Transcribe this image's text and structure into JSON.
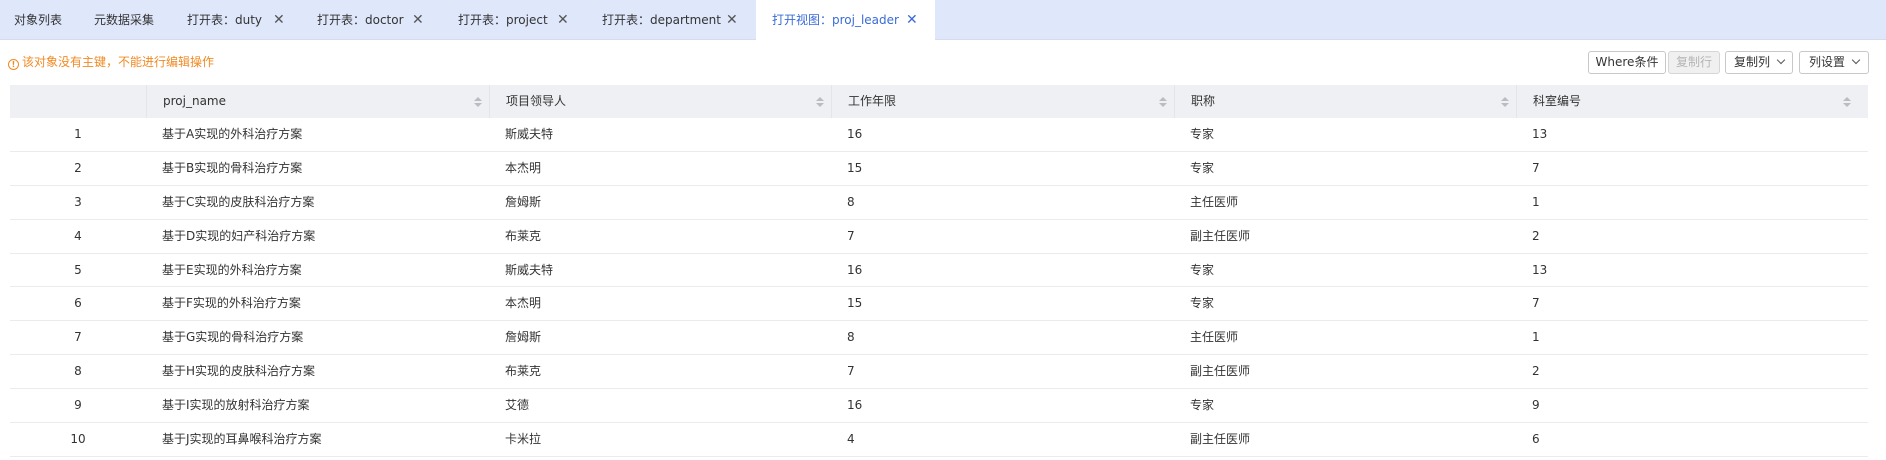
{
  "tabs": [
    {
      "label": "对象列表",
      "closable": false,
      "active": false
    },
    {
      "label": "元数据采集",
      "closable": false,
      "active": false
    },
    {
      "label": "打开表：duty",
      "closable": true,
      "active": false
    },
    {
      "label": "打开表：doctor",
      "closable": true,
      "active": false
    },
    {
      "label": "打开表：project",
      "closable": true,
      "active": false
    },
    {
      "label": "打开表：department",
      "closable": true,
      "active": false
    },
    {
      "label": "打开视图：proj_leader",
      "closable": true,
      "active": true
    }
  ],
  "close_glyph": "✕",
  "warning": {
    "icon": "info-circle-icon",
    "icon_glyph": "!",
    "text": "该对象没有主键，不能进行编辑操作",
    "color": "#f08a24"
  },
  "toolbar": {
    "where_label": "Where条件",
    "copy_row_label": "复制行",
    "copy_col_label": "复制列",
    "col_settings_label": "列设置"
  },
  "colors": {
    "accent": "#3a6bd8",
    "tabbar_bg": "#dfe7fb",
    "header_bg": "#eef0f3"
  },
  "table": {
    "columns": [
      "",
      "proj_name",
      "项目领导人",
      "工作年限",
      "职称",
      "科室编号"
    ],
    "rows": [
      [
        "1",
        "基于A实现的外科治疗方案",
        "斯威夫特",
        "16",
        "专家",
        "13"
      ],
      [
        "2",
        "基于B实现的骨科治疗方案",
        "本杰明",
        "15",
        "专家",
        "7"
      ],
      [
        "3",
        "基于C实现的皮肤科治疗方案",
        "詹姆斯",
        "8",
        "主任医师",
        "1"
      ],
      [
        "4",
        "基于D实现的妇产科治疗方案",
        "布莱克",
        "7",
        "副主任医师",
        "2"
      ],
      [
        "5",
        "基于E实现的外科治疗方案",
        "斯威夫特",
        "16",
        "专家",
        "13"
      ],
      [
        "6",
        "基于F实现的外科治疗方案",
        "本杰明",
        "15",
        "专家",
        "7"
      ],
      [
        "7",
        "基于G实现的骨科治疗方案",
        "詹姆斯",
        "8",
        "主任医师",
        "1"
      ],
      [
        "8",
        "基于H实现的皮肤科治疗方案",
        "布莱克",
        "7",
        "副主任医师",
        "2"
      ],
      [
        "9",
        "基于I实现的放射科治疗方案",
        "艾德",
        "16",
        "专家",
        "9"
      ],
      [
        "10",
        "基于J实现的耳鼻喉科治疗方案",
        "卡米拉",
        "4",
        "副主任医师",
        "6"
      ]
    ]
  }
}
